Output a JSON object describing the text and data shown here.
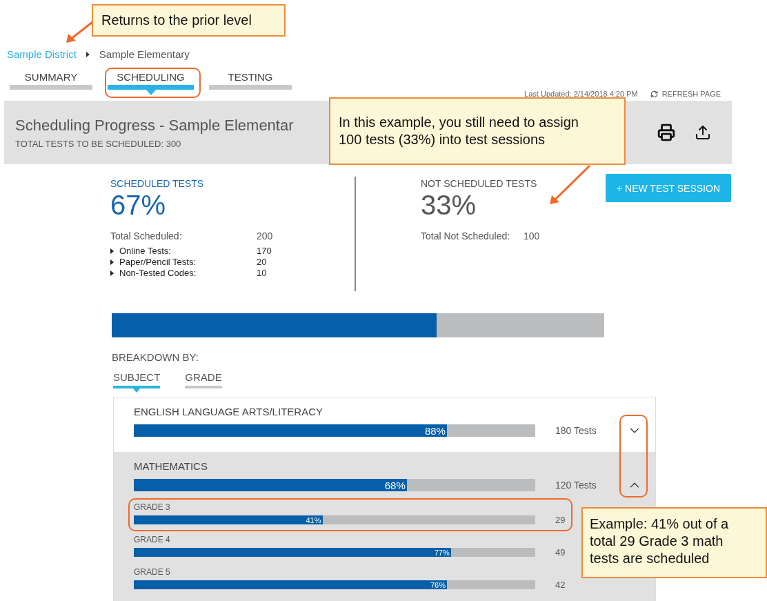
{
  "breadcrumb": [
    {
      "label": "Sample District",
      "kind": "link"
    },
    {
      "label": "Sample Elementary",
      "kind": "current"
    }
  ],
  "tabs": [
    {
      "label": "SUMMARY",
      "selected": false
    },
    {
      "label": "SCHEDULING",
      "selected": true,
      "highlighted": true
    },
    {
      "label": "TESTING",
      "selected": false
    }
  ],
  "last_updated": "Last Updated: 2/14/2018 4:20 PM",
  "refresh": "REFRESH PAGE",
  "header": {
    "title": "Scheduling Progress - Sample Elementar",
    "subtitle": "TOTAL TESTS TO BE SCHEDULED: 300"
  },
  "scheduled": {
    "label": "SCHEDULED TESTS",
    "percent": "67%",
    "total_label": "Total Scheduled:",
    "total_value": "200",
    "items": [
      {
        "label": "Online Tests:",
        "value": "170",
        "expanded": false
      },
      {
        "label": "Paper/Pencil Tests:",
        "value": "20",
        "expanded": false
      },
      {
        "label": "Non-Tested Codes:",
        "value": "10",
        "expanded": false
      }
    ]
  },
  "not_scheduled": {
    "label": "NOT SCHEDULED TESTS",
    "percent": "33%",
    "total_label": "Total Not Scheduled:",
    "total_value": "100"
  },
  "new_session_button": "+ NEW TEST SESSION",
  "overall_bar": {
    "level": 0.66
  },
  "breakdown_label": "BREAKDOWN BY:",
  "breakdown_tabs": [
    {
      "label": "SUBJECT",
      "selected": true
    },
    {
      "label": "GRADE",
      "selected": false
    }
  ],
  "subjects": [
    {
      "name": "ENGLISH LANGUAGE ARTS/LITERACY",
      "percent": "88%",
      "level": 0.78,
      "count": "180 Tests",
      "expanded": false
    },
    {
      "name": "MATHEMATICS",
      "percent": "68%",
      "level": 0.68,
      "count": "120 Tests",
      "expanded": true,
      "grades": [
        {
          "name": "GRADE 3",
          "percent": "41%",
          "level": 0.47,
          "count": "29",
          "highlighted": true
        },
        {
          "name": "GRADE 4",
          "percent": "77%",
          "level": 0.79,
          "count": "49"
        },
        {
          "name": "GRADE 5",
          "percent": "76%",
          "level": 0.78,
          "count": "42"
        }
      ]
    }
  ],
  "chevron_column_highlighted": true,
  "callouts": [
    {
      "text": "Returns to the prior level"
    },
    {
      "text": "In this example, you still need to assign 100 tests (33%) into test sessions"
    },
    {
      "text": "Example: 41% out of a total 29 Grade 3 math tests are scheduled"
    }
  ]
}
